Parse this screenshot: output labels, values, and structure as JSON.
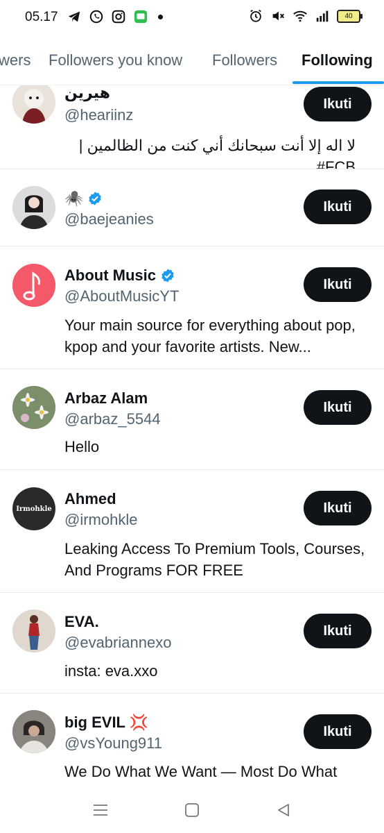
{
  "status_bar": {
    "time": "05.17",
    "battery": "40",
    "left_icons": [
      "telegram-icon",
      "whatsapp-icon",
      "instagram-icon",
      "messages-icon"
    ],
    "right_icons": [
      "alarm-icon",
      "mute-icon",
      "wifi-icon",
      "signal-icon",
      "battery-icon"
    ]
  },
  "tabs": [
    {
      "label": "wers"
    },
    {
      "label": "Followers you know"
    },
    {
      "label": "Followers"
    },
    {
      "label": "Following",
      "active": true
    }
  ],
  "accent_color": "#1d9bf0",
  "follow_label": "Ikuti",
  "users": [
    {
      "name": "هيرين",
      "handle": "@heariinz",
      "verified": false,
      "bio": "لا اله إلا أنت سبحانك أني كنت من الظالمين | FCB#"
    },
    {
      "name": "🕷️",
      "handle": "@baejeanies",
      "verified": true,
      "bio": ""
    },
    {
      "name": "About Music",
      "handle": "@AboutMusicYT",
      "verified": true,
      "bio": "Your main source for everything about pop, kpop and your favorite artists. New..."
    },
    {
      "name": "Arbaz Alam",
      "handle": "@arbaz_5544",
      "verified": false,
      "bio": "Hello"
    },
    {
      "name": "Ahmed",
      "handle": "@irmohkle",
      "verified": false,
      "avatar_text": "Irmohkle",
      "bio": "Leaking Access To Premium Tools, Courses, And Programs FOR FREE"
    },
    {
      "name": "EVA.",
      "handle": "@evabriannexo",
      "verified": false,
      "bio": "insta: eva.xxo"
    },
    {
      "name": "big EVIL 💢",
      "handle": "@vsYoung911",
      "verified": false,
      "bio": "We Do What We Want — Most Do What"
    }
  ],
  "navbar": [
    "menu-icon",
    "home-icon",
    "back-icon"
  ]
}
